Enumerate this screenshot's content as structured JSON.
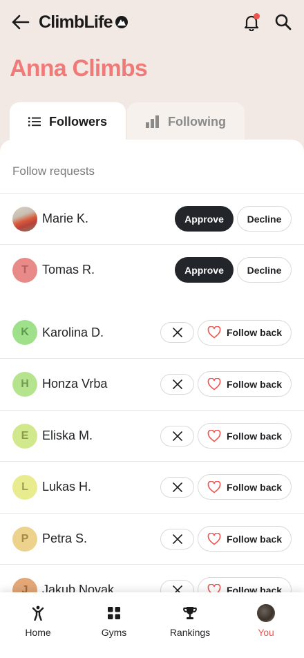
{
  "header": {
    "app_name": "ClimbLife",
    "icons": [
      "back-arrow-icon",
      "climblife-logo-icon",
      "bell-icon",
      "search-icon"
    ],
    "notification_dot_color": "#f0544f"
  },
  "profile": {
    "name": "Anna Climbs",
    "name_color": "#f07a78"
  },
  "tabs": [
    {
      "label": "Followers",
      "icon": "list-icon",
      "active": true
    },
    {
      "label": "Following",
      "icon": "bar-chart-icon",
      "active": false
    }
  ],
  "requests": {
    "title": "Follow requests",
    "approve_label": "Approve",
    "decline_label": "Decline",
    "items": [
      {
        "name": "Marie K.",
        "avatar_type": "photo"
      },
      {
        "name": "Tomas R.",
        "initial": "T",
        "avatar_color": "#e88a88"
      }
    ]
  },
  "followers": {
    "follow_back_label": "Follow back",
    "items": [
      {
        "name": "Karolina D.",
        "initial": "K",
        "avatar_color": "#9fe08a"
      },
      {
        "name": "Honza Vrba",
        "initial": "H",
        "avatar_color": "#b6e48e"
      },
      {
        "name": "Eliska M.",
        "initial": "E",
        "avatar_color": "#d2e88c"
      },
      {
        "name": "Lukas H.",
        "initial": "L",
        "avatar_color": "#e8ec8e"
      },
      {
        "name": "Petra S.",
        "initial": "P",
        "avatar_color": "#ecd28c"
      },
      {
        "name": "Jakub Novak",
        "initial": "J",
        "avatar_color": "#e3a778"
      }
    ]
  },
  "bottom_nav": {
    "items": [
      {
        "label": "Home",
        "icon": "climber-icon",
        "active": false
      },
      {
        "label": "Gyms",
        "icon": "grid-icon",
        "active": false
      },
      {
        "label": "Rankings",
        "icon": "trophy-icon",
        "active": false
      },
      {
        "label": "You",
        "icon": "avatar",
        "active": true
      }
    ],
    "active_color": "#f0544f"
  }
}
